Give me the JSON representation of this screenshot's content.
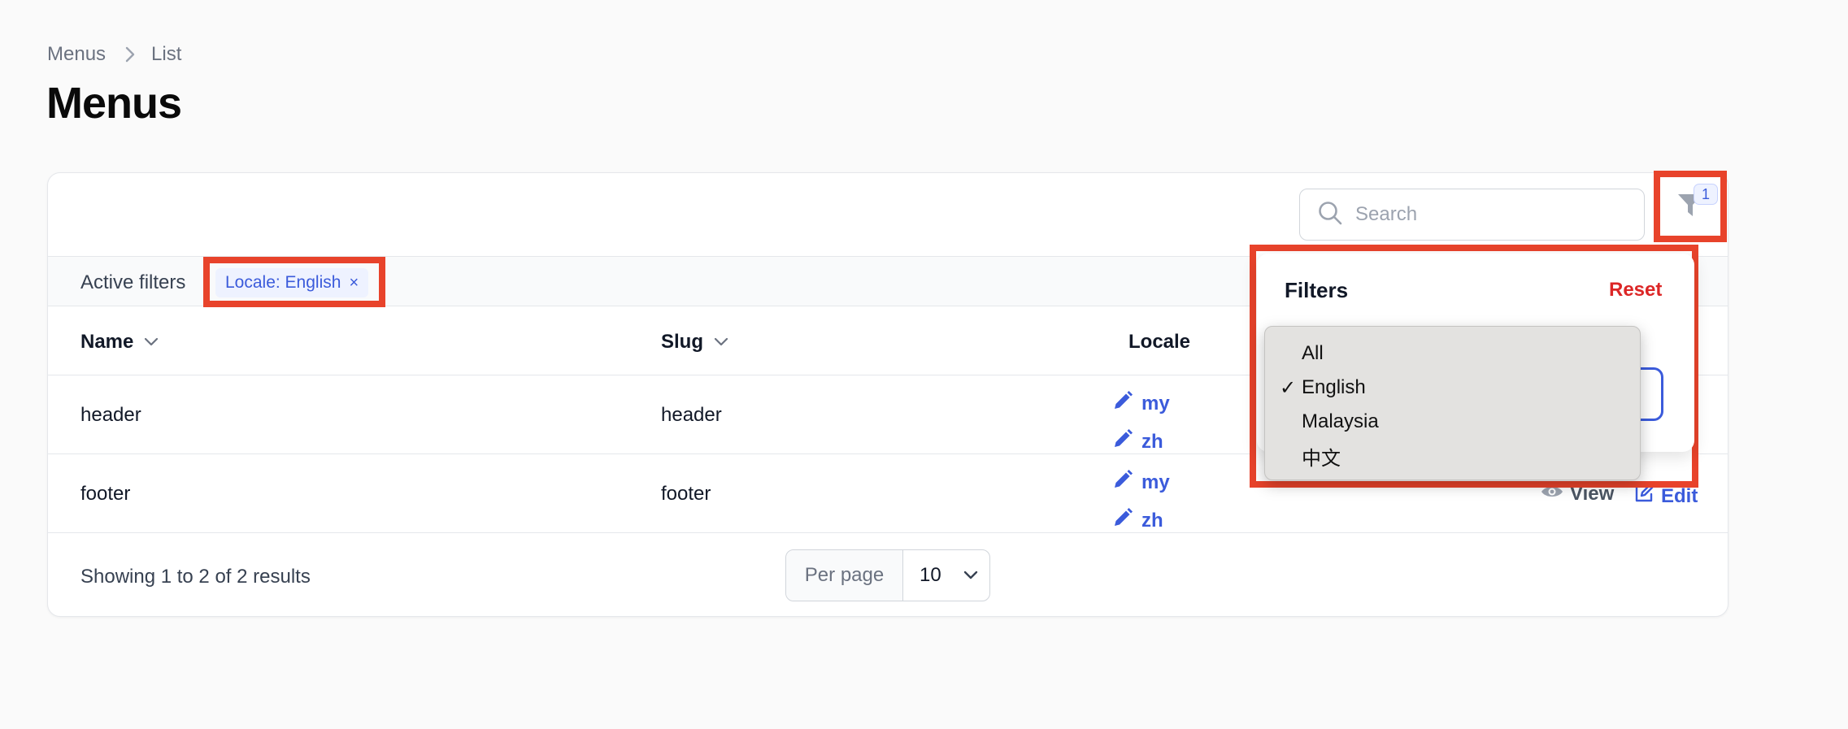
{
  "breadcrumb": {
    "items": [
      "Menus",
      "List"
    ]
  },
  "page": {
    "title": "Menus"
  },
  "toolbar": {
    "search_placeholder": "Search",
    "filter_count": "1"
  },
  "active_filters": {
    "label": "Active filters",
    "chips": [
      {
        "label": "Locale: English",
        "remove": "×"
      }
    ]
  },
  "table": {
    "columns": [
      {
        "label": "Name",
        "sortable": true
      },
      {
        "label": "Slug",
        "sortable": true
      },
      {
        "label": "Locale",
        "sortable": false
      }
    ],
    "rows": [
      {
        "name": "header",
        "slug": "header",
        "locales": [
          "my",
          "zh"
        ]
      },
      {
        "name": "footer",
        "slug": "footer",
        "locales": [
          "my",
          "zh"
        ],
        "actions": [
          "View",
          "Edit"
        ]
      }
    ]
  },
  "pagination": {
    "summary": "Showing 1 to 2 of 2 results",
    "per_page_label": "Per page",
    "per_page_value": "10"
  },
  "filter_panel": {
    "title": "Filters",
    "reset_label": "Reset",
    "locale_options": [
      {
        "label": "All",
        "selected": false
      },
      {
        "label": "English",
        "selected": true
      },
      {
        "label": "Malaysia",
        "selected": false
      },
      {
        "label": "中文",
        "selected": false
      }
    ],
    "check_mark": "✓"
  },
  "colors": {
    "accent": "#3b5bdb",
    "danger": "#dc2626",
    "highlight_outline": "#e8432b"
  }
}
